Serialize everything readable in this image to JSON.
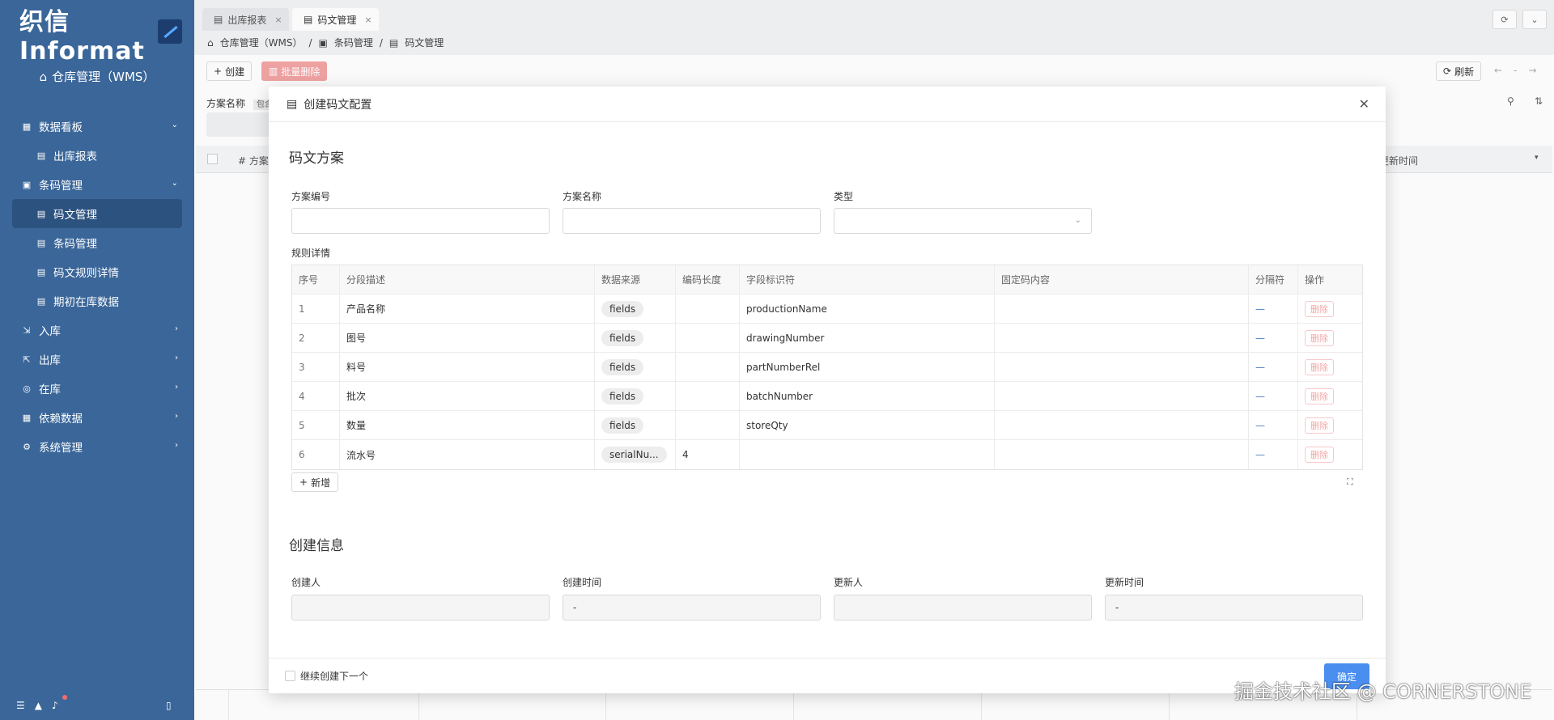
{
  "sidebar": {
    "brand": "织信 Informat",
    "app_title": "仓库管理（WMS）",
    "items": [
      {
        "label": "数据看板",
        "type": "group",
        "expanded": true
      },
      {
        "label": "出库报表",
        "type": "child"
      },
      {
        "label": "条码管理",
        "type": "group",
        "expanded": true
      },
      {
        "label": "码文管理",
        "type": "child",
        "active": true
      },
      {
        "label": "条码管理",
        "type": "child"
      },
      {
        "label": "码文规则详情",
        "type": "child"
      },
      {
        "label": "期初在库数据",
        "type": "child"
      },
      {
        "label": "入库",
        "type": "group"
      },
      {
        "label": "出库",
        "type": "group"
      },
      {
        "label": "在库",
        "type": "group"
      },
      {
        "label": "依赖数据",
        "type": "group"
      },
      {
        "label": "系统管理",
        "type": "group"
      }
    ]
  },
  "tabs": [
    {
      "label": "出库报表"
    },
    {
      "label": "码文管理",
      "active": true
    }
  ],
  "breadcrumb": [
    "仓库管理（WMS）",
    "条码管理",
    "码文管理"
  ],
  "toolbar": {
    "create_label": "创建",
    "batch_delete_label": "批量删除",
    "refresh_label": "刷新",
    "page_sep": "-"
  },
  "filter": {
    "label": "方案名称",
    "chip": "包含"
  },
  "background_table": {
    "col_name": "# 方案",
    "col_update_time": "更新时间"
  },
  "modal": {
    "title": "创建码文配置",
    "section_scheme": "码文方案",
    "fields": {
      "scheme_code_label": "方案编号",
      "scheme_code_value": "",
      "scheme_name_label": "方案名称",
      "scheme_name_value": "",
      "type_label": "类型",
      "type_value": ""
    },
    "rules_label": "规则详情",
    "grid": {
      "headers": [
        "序号",
        "分段描述",
        "数据来源",
        "编码长度",
        "字段标识符",
        "固定码内容",
        "分隔符",
        "操作"
      ],
      "rows": [
        {
          "no": "1",
          "desc": "产品名称",
          "source": "fields",
          "length": "",
          "field": "productionName",
          "fixed": "",
          "sep": "—",
          "action": "删除"
        },
        {
          "no": "2",
          "desc": "图号",
          "source": "fields",
          "length": "",
          "field": "drawingNumber",
          "fixed": "",
          "sep": "—",
          "action": "删除"
        },
        {
          "no": "3",
          "desc": "料号",
          "source": "fields",
          "length": "",
          "field": "partNumberRel",
          "fixed": "",
          "sep": "—",
          "action": "删除"
        },
        {
          "no": "4",
          "desc": "批次",
          "source": "fields",
          "length": "",
          "field": "batchNumber",
          "fixed": "",
          "sep": "—",
          "action": "删除"
        },
        {
          "no": "5",
          "desc": "数量",
          "source": "fields",
          "length": "",
          "field": "storeQty",
          "fixed": "",
          "sep": "—",
          "action": "删除"
        },
        {
          "no": "6",
          "desc": "流水号",
          "source": "serialNu...",
          "length": "4",
          "field": "",
          "fixed": "",
          "sep": "—",
          "action": "删除"
        }
      ]
    },
    "add_row_label": "新增",
    "section_create": "创建信息",
    "create_fields": {
      "creator_label": "创建人",
      "creator_value": "",
      "create_time_label": "创建时间",
      "create_time_value": "-",
      "updater_label": "更新人",
      "updater_value": "",
      "update_time_label": "更新时间",
      "update_time_value": "-"
    },
    "continue_label": "继续创建下一个",
    "confirm_label": "确定"
  },
  "watermark": "掘金技术社区 @ CORNERSTONE",
  "colors": {
    "sidebar_bg": "#3a6699",
    "primary": "#4a8ef0",
    "danger_light": "#f3a5a5"
  }
}
